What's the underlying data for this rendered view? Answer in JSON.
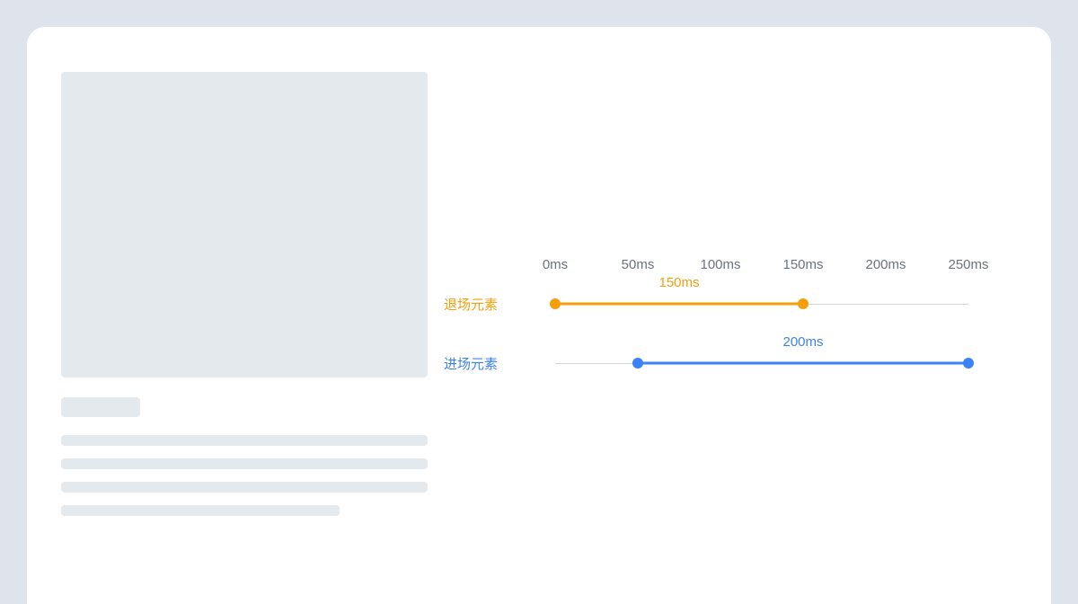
{
  "chart_data": {
    "type": "timeline",
    "title": "",
    "ticks": [
      "0ms",
      "50ms",
      "100ms",
      "150ms",
      "200ms",
      "250ms"
    ],
    "tick_values": [
      0,
      50,
      100,
      150,
      200,
      250
    ],
    "xlim": [
      0,
      250
    ],
    "series": [
      {
        "name": "退场元素",
        "start_ms": 0,
        "end_ms": 150,
        "duration_label": "150ms",
        "color": "#f59e0b"
      },
      {
        "name": "进场元素",
        "start_ms": 50,
        "end_ms": 250,
        "duration_label": "200ms",
        "color": "#3b82f6"
      }
    ]
  },
  "ticks": {
    "t0": "0ms",
    "t1": "50ms",
    "t2": "100ms",
    "t3": "150ms",
    "t4": "200ms",
    "t5": "250ms"
  },
  "rows": {
    "exit": {
      "label": "退场元素",
      "duration": "150ms"
    },
    "enter": {
      "label": "进场元素",
      "duration": "200ms"
    }
  }
}
